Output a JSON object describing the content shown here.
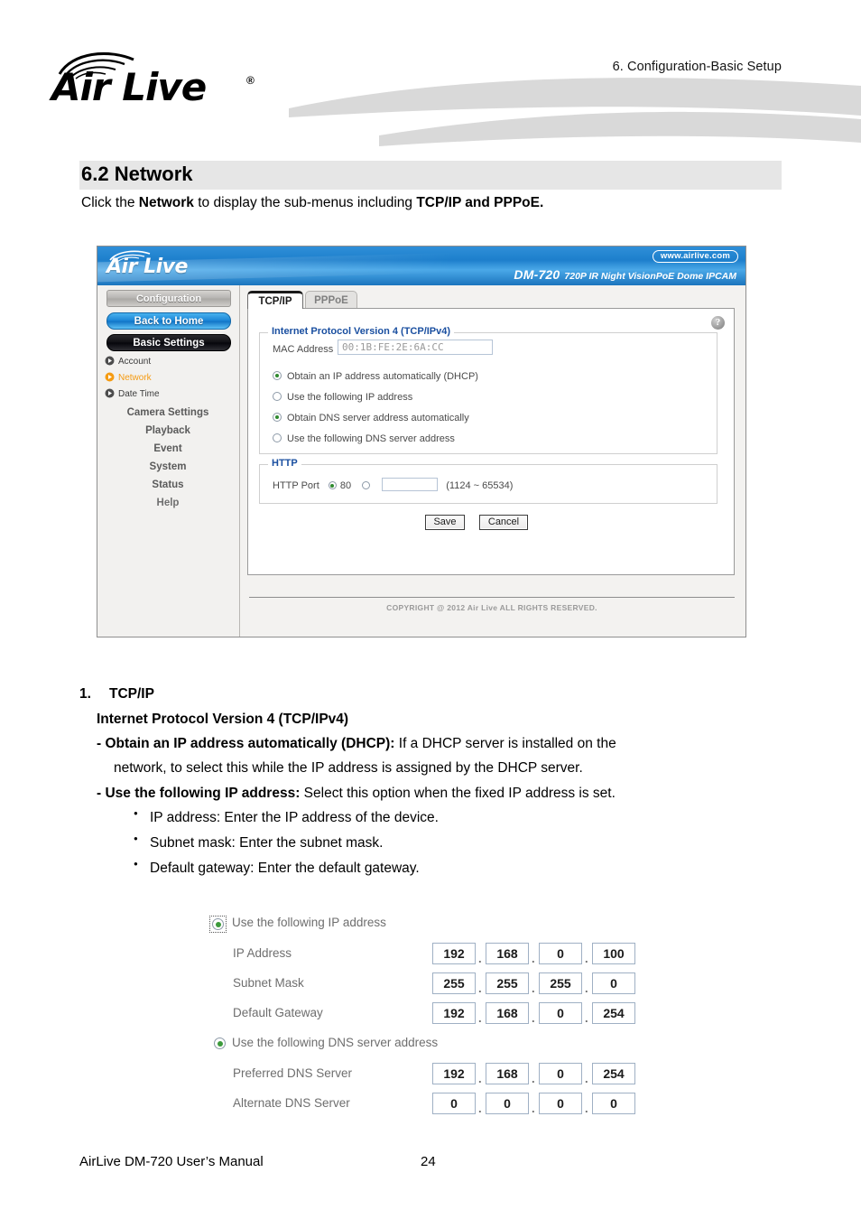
{
  "page_header": {
    "running_head": "6.  Configuration-Basic  Setup",
    "logo_text": "Air Live",
    "logo_registered": "®"
  },
  "section": {
    "heading": "6.2 Network",
    "intro_prefix": "Click the ",
    "intro_bold1": "Network",
    "intro_mid": " to display the sub-menus including ",
    "intro_bold2": "TCP/IP and PPPoE."
  },
  "camera_ui": {
    "brand": "Air Live",
    "website_badge": "www.airlive.com",
    "model": "DM-720",
    "model_desc": "720P IR Night VisionPoE Dome IPCAM",
    "sidebar": {
      "buttons": [
        {
          "label": "Configuration",
          "style": "gray"
        },
        {
          "label": "Back to Home",
          "style": "blue"
        },
        {
          "label": "Basic Settings",
          "style": "black"
        }
      ],
      "sub_items": [
        {
          "label": "Account",
          "active": false
        },
        {
          "label": "Network",
          "active": true
        },
        {
          "label": "Date Time",
          "active": false
        }
      ],
      "menu_items": [
        "Camera Settings",
        "Playback",
        "Event",
        "System",
        "Status",
        "Help"
      ]
    },
    "tabs": [
      {
        "label": "TCP/IP",
        "active": true
      },
      {
        "label": "PPPoE",
        "active": false
      }
    ],
    "help_icon": "question-mark",
    "ipv4": {
      "legend": "Internet Protocol Version 4 (TCP/IPv4)",
      "mac_label": "MAC Address",
      "mac_value": "00:1B:FE:2E:6A:CC",
      "options": [
        {
          "label": "Obtain an IP address automatically (DHCP)",
          "selected": true
        },
        {
          "label": "Use the following IP address",
          "selected": false
        },
        {
          "label": "Obtain DNS server address automatically",
          "selected": true
        },
        {
          "label": "Use the following DNS server address",
          "selected": false
        }
      ]
    },
    "http": {
      "legend": "HTTP",
      "port_label": "HTTP Port",
      "default_port": "80",
      "default_selected": true,
      "custom_selected": false,
      "custom_value": "",
      "range_note": "(1124 ~ 65534)"
    },
    "buttons": {
      "save": "Save",
      "cancel": "Cancel"
    },
    "copyright": "COPYRIGHT @ 2012 Air Live ALL RIGHTS RESERVED."
  },
  "body": {
    "item_number": "1.",
    "item_title": "TCP/IP",
    "subtitle": "Internet Protocol Version 4 (TCP/IPv4)",
    "dhcp_term": "- Obtain an IP address automatically (DHCP):",
    "dhcp_desc": " If a DHCP server is installed on the",
    "dhcp_desc2": "network, to select this while the IP address is assigned by the DHCP server.",
    "static_term": "- Use the following IP address:",
    "static_desc": " Select this option when the fixed IP address is set.",
    "bullets": [
      "IP address: Enter the IP address of the device.",
      "Subnet mask: Enter the subnet mask.",
      "Default gateway: Enter the default gateway."
    ]
  },
  "ip_figure": {
    "radio_ip": {
      "label": "Use the following IP address",
      "selected": true,
      "focused": true
    },
    "radio_dns": {
      "label": "Use the following DNS server address",
      "selected": true,
      "focused": false
    },
    "rows": [
      {
        "label": "IP Address",
        "octets": [
          "192",
          "168",
          "0",
          "100"
        ]
      },
      {
        "label": "Subnet Mask",
        "octets": [
          "255",
          "255",
          "255",
          "0"
        ]
      },
      {
        "label": "Default Gateway",
        "octets": [
          "192",
          "168",
          "0",
          "254"
        ]
      },
      {
        "label": "Preferred DNS Server",
        "octets": [
          "192",
          "168",
          "0",
          "254"
        ]
      },
      {
        "label": "Alternate DNS Server",
        "octets": [
          "0",
          "0",
          "0",
          "0"
        ]
      }
    ],
    "separator": "."
  },
  "page_footer": {
    "manual_title": "AirLive DM-720 User’s Manual",
    "page_number": "24"
  },
  "colors": {
    "accent_blue": "#1d7fcc",
    "active_orange": "#f59b12",
    "legend_blue": "#1a4fa0",
    "heading_bar": "#e6e6e6",
    "radio_green": "#3c9a3c"
  }
}
